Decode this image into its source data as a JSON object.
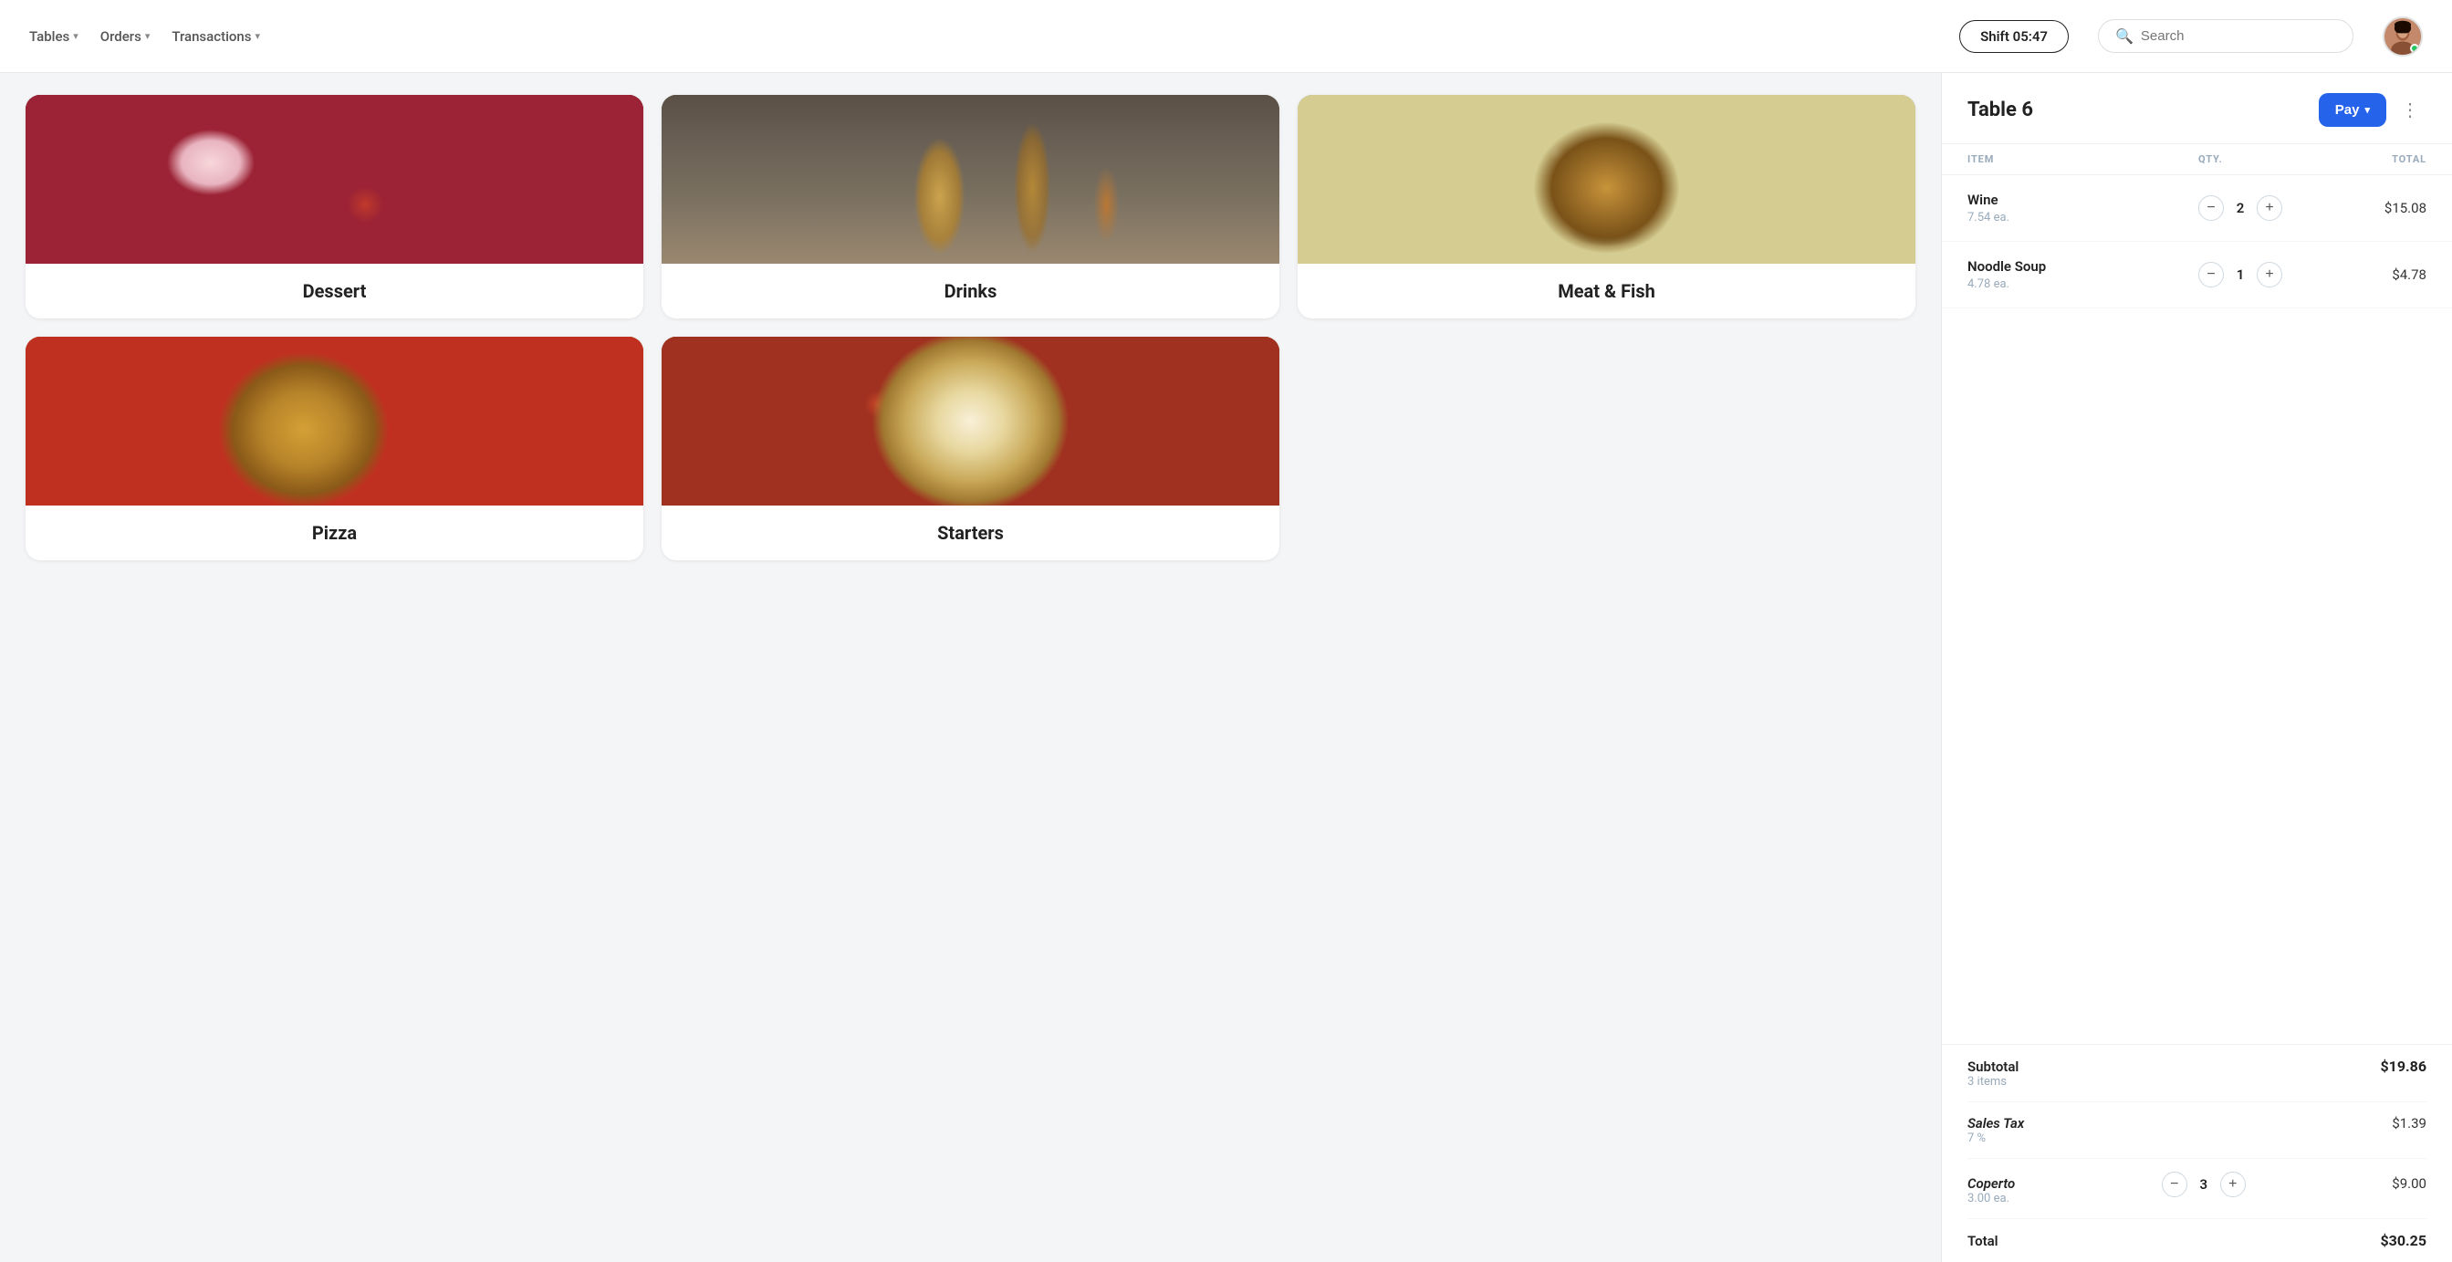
{
  "header": {
    "nav": [
      {
        "label": "Tables",
        "id": "tables"
      },
      {
        "label": "Orders",
        "id": "orders"
      },
      {
        "label": "Transactions",
        "id": "transactions"
      }
    ],
    "shift": "Shift 05:47",
    "search_placeholder": "Search"
  },
  "categories": [
    {
      "id": "dessert",
      "label": "Dessert",
      "img_class": "img-dessert"
    },
    {
      "id": "drinks",
      "label": "Drinks",
      "img_class": "img-drinks"
    },
    {
      "id": "meat-fish",
      "label": "Meat & Fish",
      "img_class": "img-meat"
    },
    {
      "id": "pizza",
      "label": "Pizza",
      "img_class": "img-pizza"
    },
    {
      "id": "starters",
      "label": "Starters",
      "img_class": "img-starters"
    }
  ],
  "order": {
    "table": "Table 6",
    "pay_label": "Pay",
    "columns": {
      "item": "ITEM",
      "qty": "QTY.",
      "total": "TOTAL"
    },
    "items": [
      {
        "name": "Wine",
        "price_ea": "7.54 ea.",
        "qty": 2,
        "total": "$15.08"
      },
      {
        "name": "Noodle Soup",
        "price_ea": "4.78 ea.",
        "qty": 1,
        "total": "$4.78"
      }
    ],
    "subtotal": {
      "label": "Subtotal",
      "sublabel": "3 items",
      "value": "$19.86"
    },
    "tax": {
      "label": "Sales Tax",
      "sublabel": "7 %",
      "value": "$1.39"
    },
    "coperto": {
      "label": "Coperto",
      "price_ea": "3.00 ea.",
      "qty": 3,
      "value": "$9.00"
    },
    "total": {
      "label": "Total",
      "value": "$30.25"
    }
  }
}
